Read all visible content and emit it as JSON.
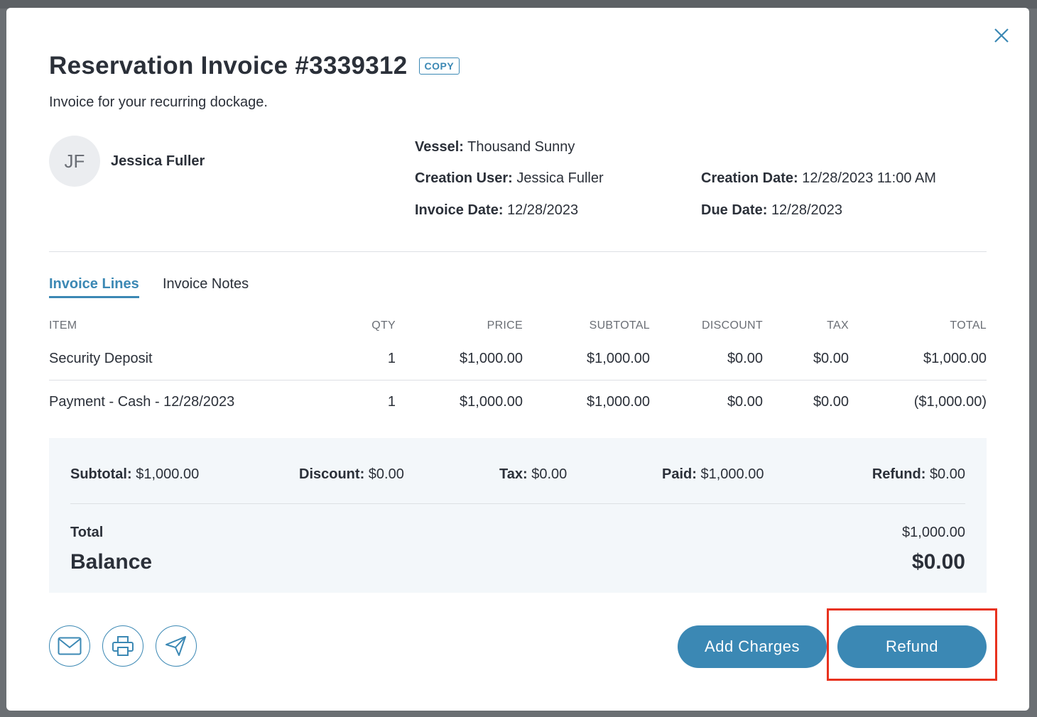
{
  "invoice": {
    "title": "Reservation Invoice #3339312",
    "copy_label": "COPY",
    "subtitle": "Invoice for your recurring dockage."
  },
  "customer": {
    "initials": "JF",
    "name": "Jessica Fuller"
  },
  "meta": {
    "vessel_label": "Vessel",
    "vessel": "Thousand Sunny",
    "creation_user_label": "Creation User",
    "creation_user": "Jessica Fuller",
    "creation_date_label": "Creation Date",
    "creation_date": "12/28/2023 11:00 AM",
    "invoice_date_label": "Invoice Date",
    "invoice_date": "12/28/2023",
    "due_date_label": "Due Date",
    "due_date": "12/28/2023"
  },
  "tabs": [
    {
      "label": "Invoice Lines",
      "active": true
    },
    {
      "label": "Invoice Notes",
      "active": false
    }
  ],
  "table": {
    "headers": [
      "ITEM",
      "QTY",
      "PRICE",
      "SUBTOTAL",
      "DISCOUNT",
      "TAX",
      "TOTAL"
    ],
    "rows": [
      [
        "Security Deposit",
        "1",
        "$1,000.00",
        "$1,000.00",
        "$0.00",
        "$0.00",
        "$1,000.00"
      ],
      [
        "Payment - Cash - 12/28/2023",
        "1",
        "$1,000.00",
        "$1,000.00",
        "$0.00",
        "$0.00",
        "($1,000.00)"
      ]
    ]
  },
  "summary": {
    "subtotal_label": "Subtotal",
    "subtotal": "$1,000.00",
    "discount_label": "Discount",
    "discount": "$0.00",
    "tax_label": "Tax",
    "tax": "$0.00",
    "paid_label": "Paid",
    "paid": "$1,000.00",
    "refund_label": "Refund",
    "refund": "$0.00",
    "total_label": "Total",
    "total": "$1,000.00",
    "balance_label": "Balance",
    "balance": "$0.00"
  },
  "actions": {
    "email_icon": "mail-icon",
    "print_icon": "printer-icon",
    "send_icon": "paper-plane-icon",
    "add_charges_label": "Add Charges",
    "refund_label": "Refund"
  },
  "colors": {
    "accent": "#3b88b4",
    "highlight": "#e8321e",
    "summary_bg": "#f3f7fa"
  }
}
